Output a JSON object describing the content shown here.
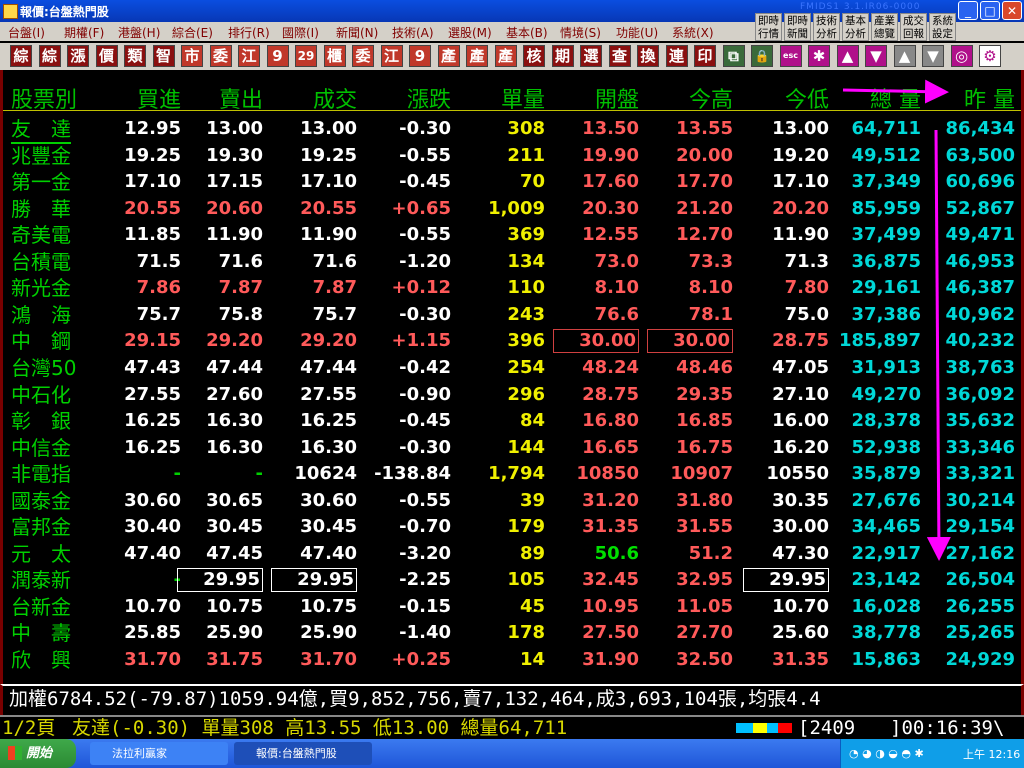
{
  "window": {
    "title": "報價:台盤熱門股",
    "version": "FMIDS1 3.1.IR06-0000"
  },
  "menu": [
    "台盤(I)",
    "期權(F)",
    "港盤(H)",
    "綜合(E)",
    "排行(R)",
    "國際(I)",
    "新聞(N)",
    "技術(A)",
    "選股(M)",
    "基本(B)",
    "情境(S)",
    "功能(U)",
    "系統(X)"
  ],
  "quick_buttons": [
    [
      "即時",
      "行情"
    ],
    [
      "即時",
      "新聞"
    ],
    [
      "技術",
      "分析"
    ],
    [
      "基本",
      "分析"
    ],
    [
      "產業",
      "總覽"
    ],
    [
      "成交",
      "回報"
    ],
    [
      "系統",
      "設定"
    ]
  ],
  "toolbar": [
    {
      "label": "綜",
      "bg": "#8a1010"
    },
    {
      "label": "綜",
      "bg": "#8a1010"
    },
    {
      "label": "漲",
      "bg": "#8a1010"
    },
    {
      "label": "價",
      "bg": "#8a1010"
    },
    {
      "label": "類",
      "bg": "#8a1010"
    },
    {
      "label": "智",
      "bg": "#8a1010"
    },
    {
      "label": "市",
      "bg": "#c0382a"
    },
    {
      "label": "委",
      "bg": "#c0382a"
    },
    {
      "label": "江",
      "bg": "#c0382a"
    },
    {
      "label": "9",
      "bg": "#c0382a"
    },
    {
      "label": "29",
      "bg": "#c0382a"
    },
    {
      "label": "櫃",
      "bg": "#c0382a"
    },
    {
      "label": "委",
      "bg": "#c0382a"
    },
    {
      "label": "江",
      "bg": "#c0382a"
    },
    {
      "label": "9",
      "bg": "#c0382a"
    },
    {
      "label": "產",
      "bg": "#c0382a"
    },
    {
      "label": "產",
      "bg": "#c0382a"
    },
    {
      "label": "產",
      "bg": "#c0382a"
    },
    {
      "label": "核",
      "bg": "#8a1010"
    },
    {
      "label": "期",
      "bg": "#8a1010"
    },
    {
      "label": "選",
      "bg": "#8a1010"
    },
    {
      "label": "查",
      "bg": "#8a1010"
    },
    {
      "label": "換",
      "bg": "#8a1010"
    },
    {
      "label": "連",
      "bg": "#8a1010"
    },
    {
      "label": "印",
      "bg": "#8a1010"
    },
    {
      "label": "⧉",
      "bg": "#3a6a3a"
    },
    {
      "label": "🔒",
      "bg": "#3a6a3a"
    },
    {
      "label": "esc",
      "bg": "#b0108a"
    },
    {
      "label": "✱",
      "bg": "#b0108a"
    },
    {
      "label": "▲",
      "bg": "#b0108a"
    },
    {
      "label": "▼",
      "bg": "#b0108a"
    },
    {
      "label": "▲",
      "bg": "#888"
    },
    {
      "label": "▼",
      "bg": "#888"
    },
    {
      "label": "◎",
      "bg": "#b0108a"
    },
    {
      "label": "⚙",
      "bg": "#ffffff"
    }
  ],
  "headers": [
    "股票別",
    "買進",
    "賣出",
    "成交",
    "漲跌",
    "單量",
    "開盤",
    "今高",
    "今低",
    "總 量",
    "昨 量"
  ],
  "rows": [
    {
      "name": "友　達",
      "buy": "12.95",
      "sell": "13.00",
      "deal": "13.00",
      "chg": "-0.30",
      "vol": "308",
      "open": "13.50",
      "high": "13.55",
      "low": "13.00",
      "total": "64,711",
      "prev": "86,434",
      "color": "#ffffff"
    },
    {
      "name": "兆豐金",
      "buy": "19.25",
      "sell": "19.30",
      "deal": "19.25",
      "chg": "-0.55",
      "vol": "211",
      "open": "19.90",
      "high": "20.00",
      "low": "19.20",
      "total": "49,512",
      "prev": "63,500",
      "color": "#ffffff"
    },
    {
      "name": "第一金",
      "buy": "17.10",
      "sell": "17.15",
      "deal": "17.10",
      "chg": "-0.45",
      "vol": "70",
      "open": "17.60",
      "high": "17.70",
      "low": "17.10",
      "total": "37,349",
      "prev": "60,696",
      "color": "#ffffff"
    },
    {
      "name": "勝　華",
      "buy": "20.55",
      "sell": "20.60",
      "deal": "20.55",
      "chg": "+0.65",
      "vol": "1,009",
      "open": "20.30",
      "high": "21.20",
      "low": "20.20",
      "total": "85,959",
      "prev": "52,867",
      "color": "#ff5a5a"
    },
    {
      "name": "奇美電",
      "buy": "11.85",
      "sell": "11.90",
      "deal": "11.90",
      "chg": "-0.55",
      "vol": "369",
      "open": "12.55",
      "high": "12.70",
      "low": "11.90",
      "total": "37,499",
      "prev": "49,471",
      "color": "#ffffff"
    },
    {
      "name": "台積電",
      "buy": "71.5",
      "sell": "71.6",
      "deal": "71.6",
      "chg": "-1.20",
      "vol": "134",
      "open": "73.0",
      "high": "73.3",
      "low": "71.3",
      "total": "36,875",
      "prev": "46,953",
      "color": "#ffffff"
    },
    {
      "name": "新光金",
      "buy": "7.86",
      "sell": "7.87",
      "deal": "7.87",
      "chg": "+0.12",
      "vol": "110",
      "open": "8.10",
      "high": "8.10",
      "low": "7.80",
      "total": "29,161",
      "prev": "46,387",
      "color": "#ff5a5a"
    },
    {
      "name": "鴻　海",
      "buy": "75.7",
      "sell": "75.8",
      "deal": "75.7",
      "chg": "-0.30",
      "vol": "243",
      "open": "76.6",
      "high": "78.1",
      "low": "75.0",
      "total": "37,386",
      "prev": "40,962",
      "color": "#ffffff"
    },
    {
      "name": "中　鋼",
      "buy": "29.15",
      "sell": "29.20",
      "deal": "29.20",
      "chg": "+1.15",
      "vol": "396",
      "open": "30.00",
      "high": "30.00",
      "low": "28.75",
      "total": "185,897",
      "prev": "40,232",
      "color": "#ff5a5a",
      "box_open": true,
      "box_high": true
    },
    {
      "name": "台灣50",
      "buy": "47.43",
      "sell": "47.44",
      "deal": "47.44",
      "chg": "-0.42",
      "vol": "254",
      "open": "48.24",
      "high": "48.46",
      "low": "47.05",
      "total": "31,913",
      "prev": "38,763",
      "color": "#ffffff"
    },
    {
      "name": "中石化",
      "buy": "27.55",
      "sell": "27.60",
      "deal": "27.55",
      "chg": "-0.90",
      "vol": "296",
      "open": "28.75",
      "high": "29.35",
      "low": "27.10",
      "total": "49,270",
      "prev": "36,092",
      "color": "#ffffff"
    },
    {
      "name": "彰　銀",
      "buy": "16.25",
      "sell": "16.30",
      "deal": "16.25",
      "chg": "-0.45",
      "vol": "84",
      "open": "16.80",
      "high": "16.85",
      "low": "16.00",
      "total": "28,378",
      "prev": "35,632",
      "color": "#ffffff"
    },
    {
      "name": "中信金",
      "buy": "16.25",
      "sell": "16.30",
      "deal": "16.30",
      "chg": "-0.30",
      "vol": "144",
      "open": "16.65",
      "high": "16.75",
      "low": "16.20",
      "total": "52,938",
      "prev": "33,346",
      "color": "#ffffff"
    },
    {
      "name": "非電指",
      "buy": "-",
      "sell": "-",
      "deal": "10624",
      "chg": "-138.84",
      "vol": "1,794",
      "open": "10850",
      "high": "10907",
      "low": "10550",
      "total": "35,879",
      "prev": "33,321",
      "color": "#ffffff",
      "dash_green": true
    },
    {
      "name": "國泰金",
      "buy": "30.60",
      "sell": "30.65",
      "deal": "30.60",
      "chg": "-0.55",
      "vol": "39",
      "open": "31.20",
      "high": "31.80",
      "low": "30.35",
      "total": "27,676",
      "prev": "30,214",
      "color": "#ffffff"
    },
    {
      "name": "富邦金",
      "buy": "30.40",
      "sell": "30.45",
      "deal": "30.45",
      "chg": "-0.70",
      "vol": "179",
      "open": "31.35",
      "high": "31.55",
      "low": "30.00",
      "total": "34,465",
      "prev": "29,154",
      "color": "#ffffff"
    },
    {
      "name": "元　太",
      "buy": "47.40",
      "sell": "47.45",
      "deal": "47.40",
      "chg": "-3.20",
      "vol": "89",
      "open": "50.6",
      "high": "51.2",
      "low": "47.30",
      "total": "22,917",
      "prev": "27,162",
      "color": "#ffffff",
      "open_green": true
    },
    {
      "name": "潤泰新",
      "buy": "-",
      "sell": "29.95",
      "deal": "29.95",
      "chg": "-2.25",
      "vol": "105",
      "open": "32.45",
      "high": "32.95",
      "low": "29.95",
      "total": "23,142",
      "prev": "26,504",
      "color": "#ffffff",
      "dash_green": true,
      "box_sell": true,
      "box_deal": true,
      "box_low": true
    },
    {
      "name": "台新金",
      "buy": "10.70",
      "sell": "10.75",
      "deal": "10.75",
      "chg": "-0.15",
      "vol": "45",
      "open": "10.95",
      "high": "11.05",
      "low": "10.70",
      "total": "16,028",
      "prev": "26,255",
      "color": "#ffffff"
    },
    {
      "name": "中　壽",
      "buy": "25.85",
      "sell": "25.90",
      "deal": "25.90",
      "chg": "-1.40",
      "vol": "178",
      "open": "27.50",
      "high": "27.70",
      "low": "25.60",
      "total": "38,778",
      "prev": "25,265",
      "color": "#ffffff"
    },
    {
      "name": "欣　興",
      "buy": "31.70",
      "sell": "31.75",
      "deal": "31.70",
      "chg": "+0.25",
      "vol": "14",
      "open": "31.90",
      "high": "32.50",
      "low": "31.35",
      "total": "15,863",
      "prev": "24,929",
      "color": "#ff5a5a"
    }
  ],
  "summary": "加權6784.52(-79.87)1059.94億,買9,852,756,賣7,132,464,成3,693,104張,均張4.4",
  "status": {
    "page": "1/2頁",
    "text": "友達(-0.30) 單量308 高13.55 低13.00 總量64,711",
    "code": "[2409",
    "time": "]00:16:39\\"
  },
  "taskbar": {
    "start": "開始",
    "tasks": [
      "法拉利贏家",
      "報價:台盤熱門股"
    ],
    "clock": "上午 12:16"
  },
  "colors": {
    "up": "#ff5a5a",
    "down": "#ffffff",
    "volume": "#f0f000",
    "total": "#00d8d8",
    "name": "#00d000",
    "annotation": "#ff00ff"
  }
}
